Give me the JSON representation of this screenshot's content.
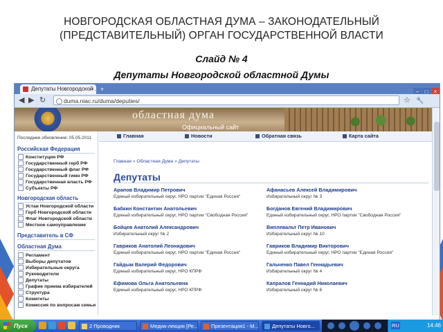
{
  "slide": {
    "title_line1": "НОВГОРОДСКАЯ ОБЛАСТНАЯ ДУМА – ЗАКОНОДАТЕЛЬНЫЙ",
    "title_line2": "(ПРЕДСТАВИТЕЛЬНЫЙ) ОРГАН ГОСУДАРСТВЕННОЙ ВЛАСТИ",
    "slide_number": "Слайд № 4",
    "subtitle": "Депутаты Новгородской областной Думы",
    "accent_colors": [
      "#e2522b",
      "#3a6fc2",
      "#f6a51b"
    ]
  },
  "browser": {
    "tab_title": "Депутаты Новгородской ...",
    "tab_close": "×",
    "new_tab": "+",
    "url": "duma.niac.ru/duma/deputies/",
    "nav_back": "◀",
    "nav_forward": "▶",
    "reload": "↻",
    "star": "☆",
    "wrench": "🔧",
    "win_min": "–",
    "win_max": "□",
    "win_close": "×"
  },
  "site": {
    "banner_title": "областная дума",
    "banner_sub": "Официальный сайт",
    "last_update": "Последнее обновление: 05.05.2011",
    "menu": [
      "Главная",
      "Новости",
      "Обратная связь",
      "Карта сайта"
    ],
    "breadcrumb": "Главная » Областная Дума » Депутаты",
    "heading": "Депутаты"
  },
  "sidebar": {
    "sections": [
      {
        "title": "Российская Федерация",
        "items": [
          "Конституция РФ",
          "Государственный герб РФ",
          "Государственный флаг РФ",
          "Государственный гимн РФ",
          "Государственная власть РФ",
          "Субъекты РФ"
        ]
      },
      {
        "title": "Новгородская область",
        "items": [
          "Устав Новгородской области",
          "Герб Новгородской области",
          "Флаг Новгородской области",
          "Местное самоуправление"
        ]
      },
      {
        "title": "Представитель в СФ",
        "items": []
      },
      {
        "title": "Областная Дума",
        "items": [
          "Регламент",
          "Выборы депутатов",
          "Избирательные округа",
          "Руководители",
          "Депутаты",
          "График приема избирателей",
          "Структура",
          "Комитеты",
          "Комиссия по вопросам семьи"
        ]
      }
    ]
  },
  "deputies": {
    "left": [
      {
        "name": "Арапов Владимир Петрович",
        "desc": "Единый избирательный округ, НРО партии \"Единая Россия\""
      },
      {
        "name": "Бабкин Константин Анатольевич",
        "desc": "Единый избирательный округ, НРО партии \"Свободная Россия\""
      },
      {
        "name": "Бойцев Анатолий Александрович",
        "desc": "Избирательный округ № 2"
      },
      {
        "name": "Гавриков Анатолий Леонидович",
        "desc": "Единый избирательный округ, НРО партии \"Единая Россия\""
      },
      {
        "name": "Гайдым Валерий Федорович",
        "desc": "Единый избирательный округ, НРО КПРФ"
      },
      {
        "name": "Ефимова Ольга Анатольевна",
        "desc": "Единый избирательный округ, НРО КПРФ"
      }
    ],
    "right": [
      {
        "name": "Афанасьев Алексей Владимирович",
        "desc": "Избирательный округ № 3"
      },
      {
        "name": "Богданов Евгений Владимирович",
        "desc": "Единый избирательный округ, НРО партии \"Свободная Россия\""
      },
      {
        "name": "Виплевальт Петр Иванович",
        "desc": "Избирательный округ № 10"
      },
      {
        "name": "Гавриков Владимир Викторович",
        "desc": "Единый избирательный округ, НРО партии \"Единая Россия\""
      },
      {
        "name": "Гальченко Павел Геннадьевич",
        "desc": "Избирательный округ № 4"
      },
      {
        "name": "Капралов Геннадий Николаевич",
        "desc": "Избирательный округ № 6"
      }
    ]
  },
  "taskbar": {
    "start": "Пуск",
    "tasks": [
      "2 Проводник",
      "Медиа-лекция [Ре...",
      "Презентация1 - М...",
      "Депутаты Новго..."
    ],
    "lang": "RU",
    "clock": "14:46"
  }
}
